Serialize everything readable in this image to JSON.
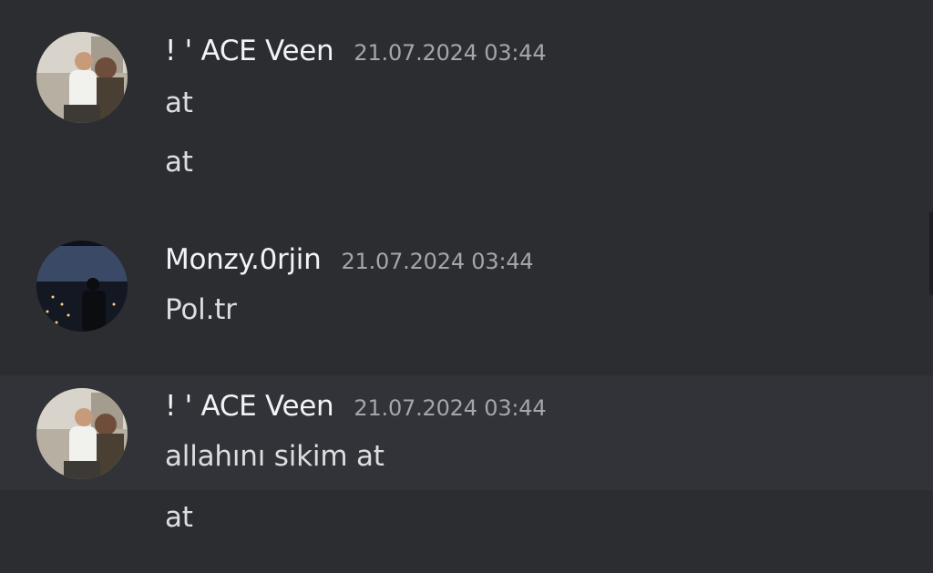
{
  "messages": [
    {
      "author": "! ' ACE Veen",
      "timestamp": "21.07.2024 03:44",
      "lines": [
        "at",
        "at"
      ]
    },
    {
      "author": "Monzy.0rjin",
      "timestamp": "21.07.2024 03:44",
      "lines": [
        "Pol.tr"
      ]
    },
    {
      "author": "! ' ACE Veen",
      "timestamp": "21.07.2024 03:44",
      "lines": [
        "allahını sikim at",
        "at"
      ]
    }
  ],
  "colors": {
    "background": "#2b2d31",
    "highlight": "#313338",
    "username": "#f2f3f5",
    "timestamp": "#a3a6aa",
    "message": "#dbdee1"
  }
}
